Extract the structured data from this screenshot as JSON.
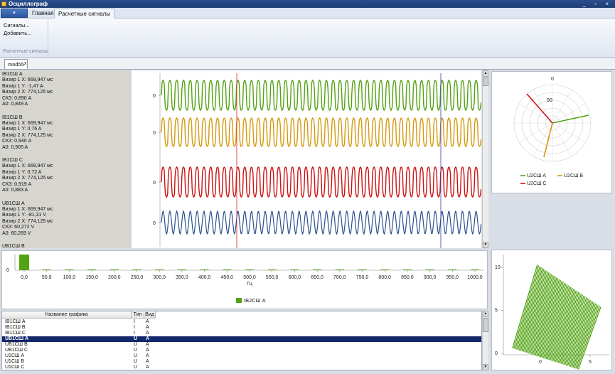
{
  "window": {
    "title": "Осциллограф",
    "controls": "_ ▫ ×"
  },
  "ribbon": {
    "app_menu_glyph": "▾",
    "tabs": [
      "Главная",
      "Расчетные сигналы"
    ],
    "group": {
      "label": "Расчетные сигналы",
      "buttons": [
        "Сигналы...",
        "Добавить..."
      ]
    }
  },
  "document_tab": {
    "label": "mod55",
    "close": "x"
  },
  "signals_info": [
    {
      "name": "IB1СШ A",
      "lines": [
        "Визир 1 X: 669,947 мс",
        "Визир 1 Y: -1,47 A",
        "Визир 2 X: 774,125 мс",
        "СКЗ: 0,890 A",
        "A0: 0,849 A"
      ]
    },
    {
      "name": "IB1СШ B",
      "lines": [
        "Визир 1 X: 669,947 мс",
        "Визир 1 Y: 0,76 A",
        "Визир 2 X: 774,125 мс",
        "СКЗ: 0,940 A",
        "A0: 0,905 A"
      ]
    },
    {
      "name": "IB1СШ C",
      "lines": [
        "Визир 1 X: 669,947 мс",
        "Визир 1 Y: 0,72 A",
        "Визир 2 X: 774,125 мс",
        "СКЗ: 0,919 A",
        "A0: 0,883 A"
      ]
    },
    {
      "name": "UB1СШ A",
      "lines": [
        "Визир 1 X: 669,947 мс",
        "Визир 1 Y: -81,31 V",
        "Визир 2 X: 774,125 мс",
        "СКЗ: 60,272 V",
        "A0: 60,269 V"
      ]
    },
    {
      "name": "UB1СШ B",
      "lines": []
    }
  ],
  "oscillogram": {
    "traces": [
      {
        "color": "#52a312",
        "axis_label": "0"
      },
      {
        "color": "#d49a10",
        "axis_label": "0"
      },
      {
        "color": "#cc1111",
        "axis_label": "0"
      },
      {
        "color": "#2a4f8f",
        "axis_label": "0"
      }
    ],
    "cursor1_color": "#e02020",
    "cursor2_color": "#3a3ab0"
  },
  "polar": {
    "top_label": "0",
    "ring_label": "50",
    "legend": [
      {
        "name": "U2СШ A",
        "color": "#52a312"
      },
      {
        "name": "U2СШ B",
        "color": "#d49a10"
      },
      {
        "name": "U2СШ C",
        "color": "#cc1111"
      }
    ]
  },
  "spectrum": {
    "y_label": "0",
    "x_unit": "Гц",
    "ticks": [
      "0,0",
      "50,0",
      "100,0",
      "150,0",
      "200,0",
      "250,0",
      "300,0",
      "350,0",
      "400,0",
      "450,0",
      "500,0",
      "550,0",
      "600,0",
      "650,0",
      "700,0",
      "750,0",
      "800,0",
      "850,0",
      "900,0",
      "950,0",
      "1000,0"
    ],
    "legend": {
      "name": "IB2СШ A",
      "color": "#52a312"
    }
  },
  "lissajous": {
    "y_ticks": [
      "10",
      "5",
      "0"
    ],
    "x_ticks": [
      "0",
      "5"
    ],
    "color": "#52a312"
  },
  "table": {
    "headers": [
      "Название графика",
      "Тип",
      "Вид"
    ],
    "rows": [
      {
        "name": "IB1СШ A",
        "type": "I",
        "kind": "A"
      },
      {
        "name": "IB1СШ B",
        "type": "I",
        "kind": "A"
      },
      {
        "name": "IB1СШ C",
        "type": "I",
        "kind": "A"
      },
      {
        "name": "UB1СШ A",
        "type": "U",
        "kind": "A",
        "selected": true
      },
      {
        "name": "UB1СШ B",
        "type": "U",
        "kind": "A"
      },
      {
        "name": "UB1СШ C",
        "type": "U",
        "kind": "A"
      },
      {
        "name": "U1СШ A",
        "type": "U",
        "kind": "A"
      },
      {
        "name": "U1СШ B",
        "type": "U",
        "kind": "A"
      },
      {
        "name": "U1СШ C",
        "type": "U",
        "kind": "A"
      }
    ]
  }
}
